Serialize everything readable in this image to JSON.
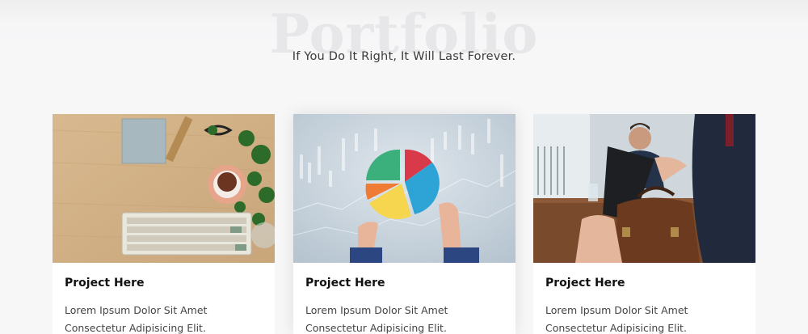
{
  "section": {
    "background_title": "Portfolio",
    "subtitle": "If You Do It Right, It Will Last Forever."
  },
  "cards": [
    {
      "image_icon": "desk-workspace-photo",
      "title": "Project Here",
      "text_line1": "Lorem Ipsum Dolor Sit Amet",
      "text_line2": "Consectetur Adipisicing Elit."
    },
    {
      "image_icon": "pie-chart-finance-photo",
      "title": "Project Here",
      "text_line1": "Lorem Ipsum Dolor Sit Amet",
      "text_line2": "Consectetur Adipisicing Elit."
    },
    {
      "image_icon": "business-meeting-briefcase-photo",
      "title": "Project Here",
      "text_line1": "Lorem Ipsum Dolor Sit Amet",
      "text_line2": "Consectetur Adipisicing Elit."
    }
  ],
  "colors": {
    "page_background": "#f7f7f8",
    "watermark_text": "#e7e7e9",
    "subtitle_text": "#3a3a3a",
    "card_title": "#111111",
    "card_text": "#444444"
  }
}
